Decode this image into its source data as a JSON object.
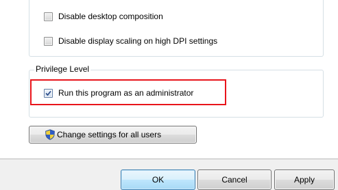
{
  "settings": {
    "items": [
      {
        "label": "Disable desktop composition",
        "checked": false
      },
      {
        "label": "Disable display scaling on high DPI settings",
        "checked": false
      }
    ]
  },
  "privilege": {
    "title": "Privilege Level",
    "run_as_admin": {
      "label": "Run this program as an administrator",
      "checked": true
    }
  },
  "change_settings_button": {
    "label": "Change settings for all users",
    "icon": "uac-shield-icon"
  },
  "footer": {
    "ok_label": "OK",
    "cancel_label": "Cancel",
    "apply_label": "Apply"
  },
  "colors": {
    "highlight_border": "#e8141b",
    "default_button_border": "#3c7fb1"
  }
}
